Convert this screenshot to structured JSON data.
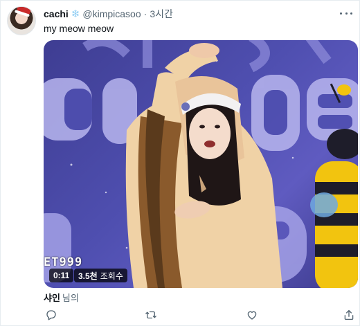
{
  "tweet": {
    "author": {
      "name": "cachi",
      "badge_icon": "snowflake-icon",
      "handle": "@kimpicasoo",
      "separator": "·",
      "time": "3시간"
    },
    "text": "my meow meow",
    "media": {
      "type": "video",
      "overlay_text": "ET999",
      "duration": "0:11",
      "views_count": "3.5천",
      "views_label": "조회수"
    },
    "attribution": {
      "name": "샤인",
      "suffix": "님의"
    },
    "actions": [
      "reply-icon",
      "retweet-icon",
      "like-icon",
      "share-icon"
    ]
  },
  "colors": {
    "text_primary": "#0f1419",
    "text_secondary": "#536471",
    "snowflake": "#8ecdf4",
    "video_background": "#4f4fb0"
  }
}
